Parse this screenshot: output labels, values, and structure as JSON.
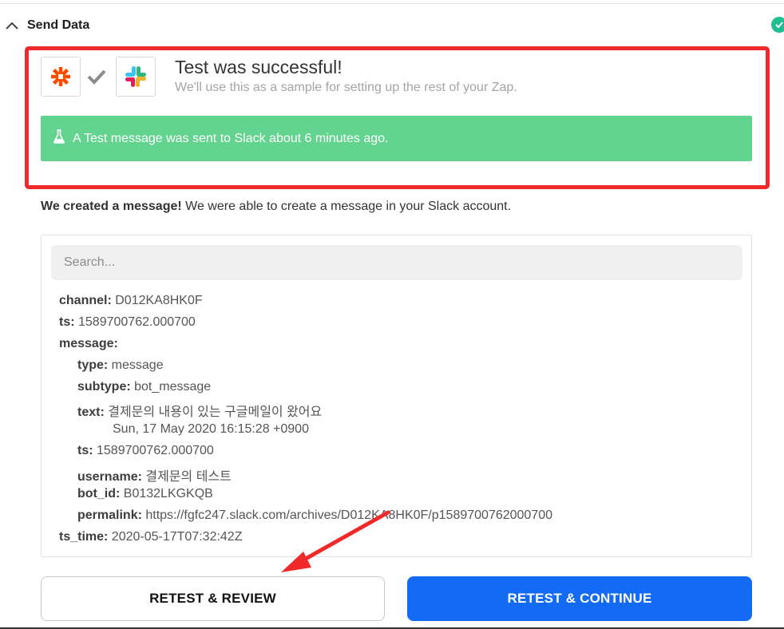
{
  "section": {
    "title": "Send Data"
  },
  "test": {
    "title": "Test was successful!",
    "subtitle": "We'll use this as a sample for setting up the rest of your Zap.",
    "alert": "A Test message was sent to Slack about 6 minutes ago."
  },
  "summary": {
    "bold": "We created a message!",
    "rest": " We were able to create a message in your Slack account."
  },
  "search": {
    "placeholder": "Search..."
  },
  "fields": [
    {
      "key": "channel:",
      "value": " D012KA8HK0F"
    },
    {
      "key": "ts:",
      "value": " 1589700762.000700"
    },
    {
      "key": "message:",
      "value": ""
    },
    {
      "key": "type:",
      "value": " message"
    },
    {
      "key": "subtype:",
      "value": " bot_message"
    },
    {
      "key": "text:",
      "value": " 결제문의 내용이 있는 구글메일이 왔어요"
    },
    {
      "key": "",
      "value": "Sun, 17 May 2020 16:15:28 +0900"
    },
    {
      "key": "ts:",
      "value": " 1589700762.000700"
    },
    {
      "key": "username:",
      "value": " 결제문의 테스트"
    },
    {
      "key": "bot_id:",
      "value": " B0132LKGKQB"
    },
    {
      "key": "permalink:",
      "value": " https://fgfc247.slack.com/archives/D012KA8HK0F/p1589700762000700"
    },
    {
      "key": "ts_time:",
      "value": " 2020-05-17T07:32:42Z"
    }
  ],
  "buttons": {
    "retest_review": "RETEST & REVIEW",
    "retest_continue": "RETEST & CONTINUE"
  },
  "icons": {
    "collapse": "chevron-up-icon",
    "status": "check-circle-icon",
    "zapier": "zapier-logo-icon",
    "slack": "slack-logo-icon",
    "connector": "check-icon",
    "alert": "flask-icon"
  },
  "colors": {
    "success_green": "#63d490",
    "status_teal": "#1ebe8f",
    "primary_blue": "#136bf5",
    "annotation_red": "#f02a2a",
    "zapier_orange": "#ff4a00"
  }
}
